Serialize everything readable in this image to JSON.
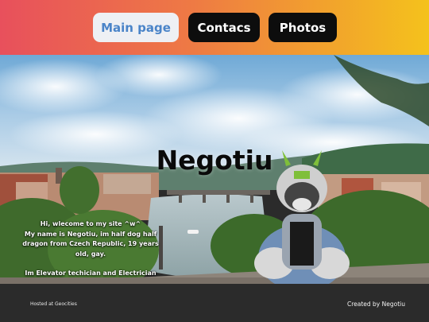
{
  "nav": {
    "main_label": "Main page",
    "contacs_label": "Contacs",
    "photos_label": "Photos"
  },
  "hero": {
    "title": "Negotiu",
    "intro_line1": "Hi, wlecome to my site ^w^",
    "intro_line2": "My name is Negotiu, im half dog half dragon from Czech Republic, 19 years old, gay.",
    "intro_line3": "Im Elevator techician and Electrician"
  },
  "footer": {
    "left": "Hosted at Geocities",
    "right": "Created by Negotiu"
  },
  "colors": {
    "header_gradient": [
      "#e8505c",
      "#f4c21c"
    ],
    "nav_active_bg": "#eef0f4",
    "nav_active_text": "#4a84c8",
    "nav_bg": "#0d0d0d",
    "footer_bg": "#2b2b2b"
  }
}
